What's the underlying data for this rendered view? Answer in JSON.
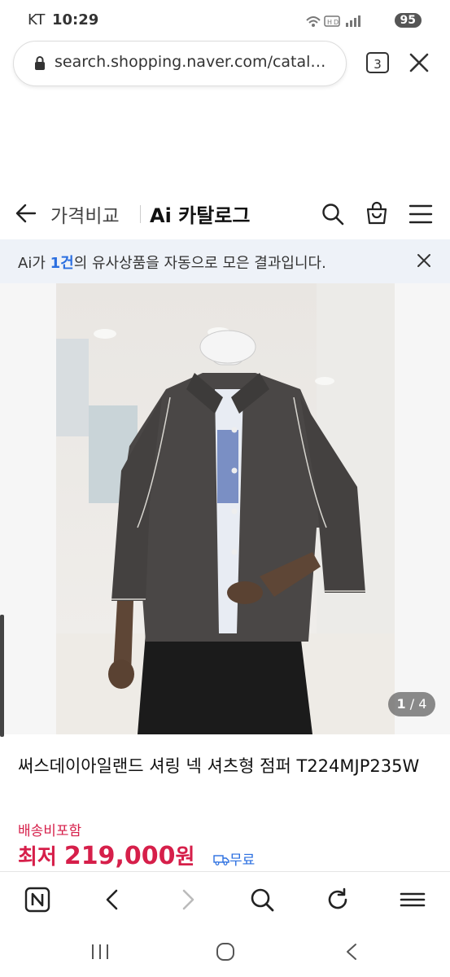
{
  "status": {
    "carrier": "KT",
    "time": "10:29",
    "battery": "95"
  },
  "browser": {
    "url": "search.shopping.naver.com/catal…",
    "tab_count": "3"
  },
  "header": {
    "title": "가격비교",
    "brand": "Ai 카탈로그"
  },
  "banner": {
    "prefix": "Ai가 ",
    "count": "1건",
    "suffix": "의 유사상품을 자동으로 모은 결과입니다."
  },
  "image": {
    "current": "1",
    "total": "4",
    "separator": " / "
  },
  "product": {
    "title": "써스데이아일랜드 셔링 넥 셔츠형 점퍼 T224MJP235W",
    "shipping": "배송비포함",
    "price_label": "최저 ",
    "price": "219,000",
    "currency": "원",
    "free_label": "무료"
  },
  "colors": {
    "accent": "#d61f4a",
    "link": "#2b6fe0",
    "banner_bg": "#eef2f8"
  }
}
